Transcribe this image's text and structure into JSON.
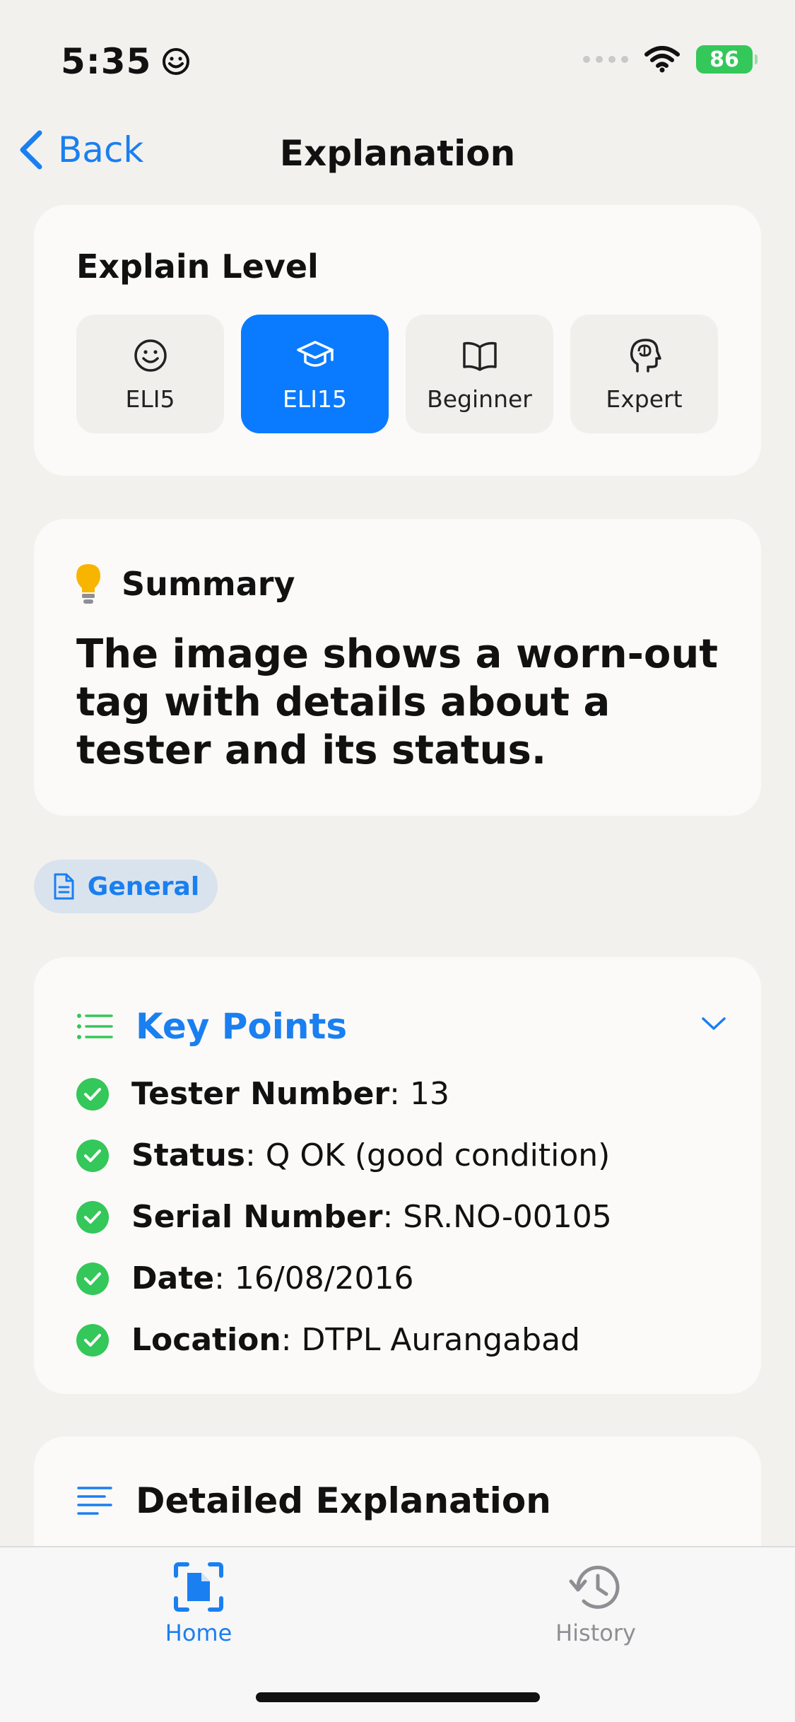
{
  "status_bar": {
    "time": "5:35",
    "battery": "86"
  },
  "nav": {
    "back_label": "Back",
    "title": "Explanation"
  },
  "explain_level": {
    "heading": "Explain Level",
    "options": [
      {
        "label": "ELI5",
        "icon": "smiley-icon"
      },
      {
        "label": "ELI15",
        "icon": "graduation-cap-icon",
        "selected": true
      },
      {
        "label": "Beginner",
        "icon": "book-icon"
      },
      {
        "label": "Expert",
        "icon": "brain-head-icon"
      }
    ]
  },
  "summary": {
    "heading": "Summary",
    "text": "The image shows a worn-out tag with details about a tester and its status."
  },
  "category_tag": "General",
  "key_points": {
    "heading": "Key Points",
    "items": [
      {
        "label": "Tester Number",
        "value": ": 13"
      },
      {
        "label": "Status",
        "value": ": Q OK (good condition)"
      },
      {
        "label": "Serial Number",
        "value": ": SR.NO-00105"
      },
      {
        "label": "Date",
        "value": ": 16/08/2016"
      },
      {
        "label": "Location",
        "value": ": DTPL Aurangabad"
      }
    ]
  },
  "detailed": {
    "heading": "Detailed Explanation"
  },
  "tabs": [
    {
      "label": "Home",
      "active": true
    },
    {
      "label": "History",
      "active": false
    }
  ],
  "colors": {
    "accent": "#1a7ff0",
    "selected": "#0a7bff",
    "check": "#34c759",
    "background": "#f3f1ee",
    "card": "#fcfaf8"
  }
}
